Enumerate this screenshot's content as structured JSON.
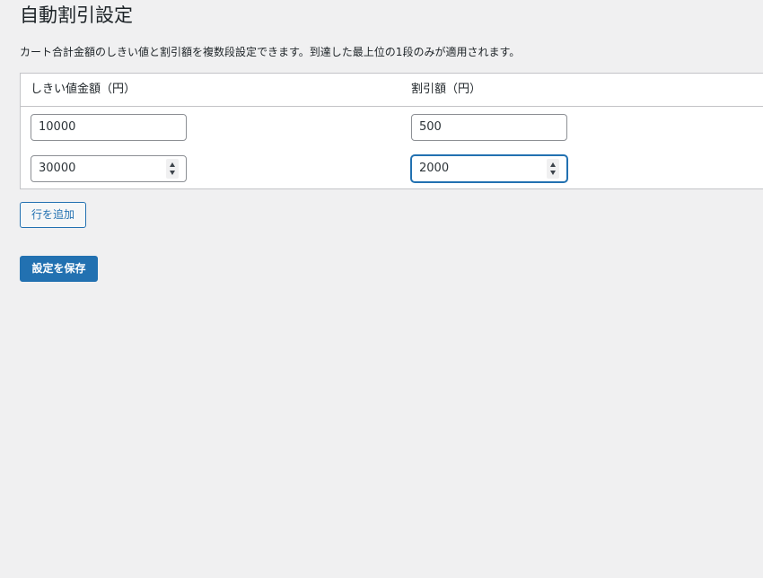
{
  "page": {
    "title": "自動割引設定",
    "description": "カート合計金額のしきい値と割引額を複数段設定できます。到達した最上位の1段のみが適用されます。"
  },
  "table": {
    "columns": [
      "しきい値金額（円）",
      "割引額（円）"
    ],
    "rows": [
      {
        "threshold": "10000",
        "discount": "500"
      },
      {
        "threshold": "30000",
        "discount": "2000"
      }
    ]
  },
  "buttons": {
    "add_row": "行を追加",
    "save": "設定を保存"
  },
  "colors": {
    "accent": "#2271b1",
    "background": "#f0f0f1",
    "border": "#c3c4c7"
  },
  "icons": {
    "spinner_up": "spin-up-icon",
    "spinner_down": "spin-down-icon"
  }
}
